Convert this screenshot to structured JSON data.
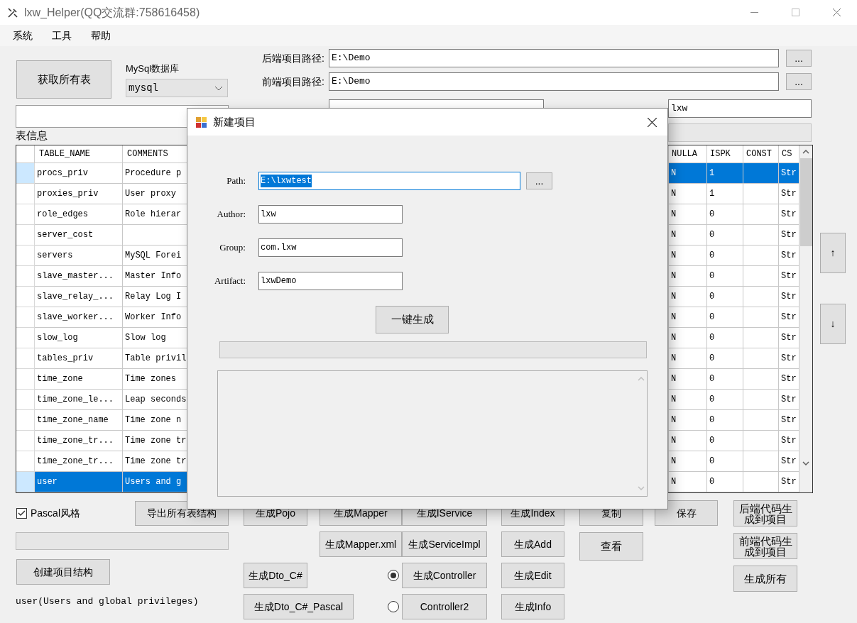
{
  "window": {
    "title": "lxw_Helper(QQ交流群:758616458)"
  },
  "menu": [
    "系统",
    "工具",
    "帮助"
  ],
  "left_panel": {
    "fetch_button": "获取所有表",
    "db_label": "MySql数据库",
    "db_select": "mysql",
    "section_label": "表信息"
  },
  "paths": [
    {
      "label": "后端项目路径:",
      "value": "E:\\Demo",
      "button": "..."
    },
    {
      "label": "前端项目路径:",
      "value": "E:\\Demo",
      "button": "..."
    }
  ],
  "author": {
    "value": "lxw"
  },
  "table": {
    "columns_left": [
      "TABLE_NAME",
      "COMMENTS"
    ],
    "columns_right": [
      "NULLA",
      "ISPK",
      "CONST",
      "CS"
    ],
    "rows": [
      {
        "table_name": "procs_priv",
        "comments": "Procedure p",
        "nullable": "N",
        "ispk": "1",
        "column_4": "Str",
        "selected": false,
        "current": true
      },
      {
        "table_name": "proxies_priv",
        "comments": "User proxy",
        "nullable": "N",
        "ispk": "1",
        "column_4": "Str",
        "selected": false,
        "current": false
      },
      {
        "table_name": "role_edges",
        "comments": "Role hierar",
        "nullable": "N",
        "ispk": "0",
        "column_4": "Str",
        "selected": false,
        "current": false
      },
      {
        "table_name": "server_cost",
        "nullable": "N",
        "ispk": "0",
        "column_4": "Str",
        "selected": false,
        "current": false
      },
      {
        "table_name": "servers",
        "comments": "MySQL Forei",
        "nullable": "N",
        "ispk": "0",
        "column_4": "Str",
        "selected": false,
        "current": false
      },
      {
        "table_name": "slave_master...",
        "comments": "Master Info",
        "nullable": "N",
        "ispk": "0",
        "column_4": "Str",
        "selected": false,
        "current": false
      },
      {
        "table_name": "slave_relay_...",
        "comments": "Relay Log I",
        "nullable": "N",
        "ispk": "0",
        "column_4": "Str",
        "selected": false,
        "current": false
      },
      {
        "table_name": "slave_worker...",
        "comments": "Worker Info",
        "nullable": "N",
        "ispk": "0",
        "column_4": "Str",
        "selected": false,
        "current": false
      },
      {
        "table_name": "slow_log",
        "comments": "Slow log",
        "nullable": "N",
        "ispk": "0",
        "column_4": "Str",
        "selected": false,
        "current": false
      },
      {
        "table_name": "tables_priv",
        "comments": "Table privil",
        "nullable": "N",
        "ispk": "0",
        "column_4": "Str",
        "selected": false,
        "current": false
      },
      {
        "table_name": "time_zone",
        "comments": "Time zones",
        "nullable": "N",
        "ispk": "0",
        "column_4": "Str",
        "selected": false,
        "current": false
      },
      {
        "table_name": "time_zone_le...",
        "comments": "Leap seconds",
        "nullable": "N",
        "ispk": "0",
        "column_4": "Str",
        "selected": false,
        "current": false
      },
      {
        "table_name": "time_zone_name",
        "comments": "Time zone n",
        "nullable": "N",
        "ispk": "0",
        "column_4": "Str",
        "selected": false,
        "current": false
      },
      {
        "table_name": "time_zone_tr...",
        "comments": "Time zone tr",
        "nullable": "N",
        "ispk": "0",
        "column_4": "Str",
        "selected": false,
        "current": false
      },
      {
        "table_name": "time_zone_tr...",
        "comments": "Time zone tr",
        "nullable": "N",
        "ispk": "0",
        "column_4": "Str",
        "selected": false,
        "current": false
      },
      {
        "table_name": "user",
        "comments": "Users and g",
        "nullable": "N",
        "ispk": "0",
        "column_4": "Str",
        "selected": true,
        "current": false
      }
    ]
  },
  "move_buttons": [
    "↑",
    "↓"
  ],
  "options": {
    "pascal": {
      "label": "Pascal风格",
      "checked": true
    },
    "export_button": "导出所有表结构",
    "progress": {
      "level": 0
    },
    "create_button": "创建项目结构",
    "status": "user(Users and global privileges)"
  },
  "button_columns": [
    [
      "生成Pojo",
      null,
      "生成Dto_C#",
      "生成Dto_C#_Pascal"
    ],
    [
      "生成Mapper",
      "生成Mapper.xml"
    ],
    [
      "生成IService",
      "生成ServiceImpl",
      "生成Controller",
      "Controller2"
    ],
    [
      "生成Index",
      "生成Add",
      "生成Edit",
      "生成Info"
    ],
    [
      "复制",
      "查看"
    ],
    [
      "保存"
    ],
    [
      "后端代码生成到项目",
      "前端代码生成到项目",
      "生成所有"
    ]
  ],
  "controller_radios": [
    {
      "selected": true
    },
    {
      "selected": false
    }
  ],
  "dialog": {
    "title": "新建项目",
    "fields": [
      {
        "label": "Path:",
        "value": "E:\\lxwtest",
        "focused": true,
        "button": "..."
      },
      {
        "label": "Author:",
        "value": "lxw",
        "focused": false
      },
      {
        "label": "Group:",
        "value": "com.lxw",
        "focused": false
      },
      {
        "label": "Artifact:",
        "value": "lxwDemo",
        "focused": false
      }
    ],
    "generate_button": "一键生成",
    "progress": {
      "level": 0
    }
  }
}
